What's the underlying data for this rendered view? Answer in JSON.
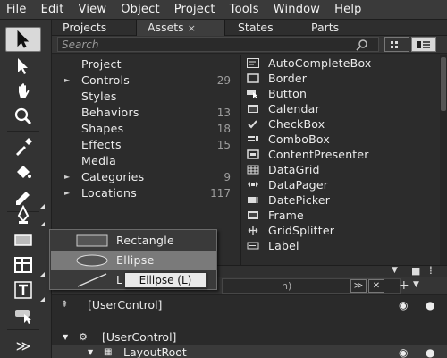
{
  "menu": [
    "File",
    "Edit",
    "View",
    "Object",
    "Project",
    "Tools",
    "Window",
    "Help"
  ],
  "tabs": [
    {
      "label": "Projects"
    },
    {
      "label": "Assets",
      "close": "×"
    },
    {
      "label": "States"
    },
    {
      "label": "Parts"
    }
  ],
  "search": {
    "placeholder": "Search"
  },
  "categories": [
    {
      "label": "Project",
      "count": "",
      "arrow": ""
    },
    {
      "label": "Controls",
      "count": "29",
      "arrow": "►"
    },
    {
      "label": "Styles",
      "count": "",
      "arrow": ""
    },
    {
      "label": "Behaviors",
      "count": "13",
      "arrow": ""
    },
    {
      "label": "Shapes",
      "count": "18",
      "arrow": ""
    },
    {
      "label": "Effects",
      "count": "15",
      "arrow": ""
    },
    {
      "label": "Media",
      "count": "",
      "arrow": ""
    },
    {
      "label": "Categories",
      "count": "9",
      "arrow": "►"
    },
    {
      "label": "Locations",
      "count": "117",
      "arrow": "►"
    }
  ],
  "controls": [
    {
      "label": "AutoCompleteBox",
      "icon": "autocomplete-icon"
    },
    {
      "label": "Border",
      "icon": "border-icon"
    },
    {
      "label": "Button",
      "icon": "button-icon"
    },
    {
      "label": "Calendar",
      "icon": "calendar-icon"
    },
    {
      "label": "CheckBox",
      "icon": "checkbox-icon"
    },
    {
      "label": "ComboBox",
      "icon": "combobox-icon"
    },
    {
      "label": "ContentPresenter",
      "icon": "contentpresenter-icon"
    },
    {
      "label": "DataGrid",
      "icon": "datagrid-icon"
    },
    {
      "label": "DataPager",
      "icon": "datapager-icon"
    },
    {
      "label": "DatePicker",
      "icon": "datepicker-icon"
    },
    {
      "label": "Frame",
      "icon": "frame-icon"
    },
    {
      "label": "GridSplitter",
      "icon": "gridsplitter-icon"
    },
    {
      "label": "Label",
      "icon": "label-icon"
    }
  ],
  "flyout": {
    "items": [
      {
        "label": "Rectangle",
        "icon": "rectangle-icon"
      },
      {
        "label": "Ellipse",
        "icon": "ellipse-icon"
      },
      {
        "label": "L",
        "icon": "line-icon"
      }
    ],
    "selected": "Ellipse"
  },
  "tooltip": "Ellipse (L)",
  "lower_search": {
    "text": "n)"
  },
  "tree": [
    {
      "label": "[UserControl]"
    },
    {
      "label": "[UserControl]"
    },
    {
      "label": "LayoutRoot"
    }
  ],
  "expand_glyph": "≫",
  "colors": {
    "panel": "#2c2c2c",
    "active_tool": "#d9d9d9",
    "selected": "#7a7a7a"
  }
}
